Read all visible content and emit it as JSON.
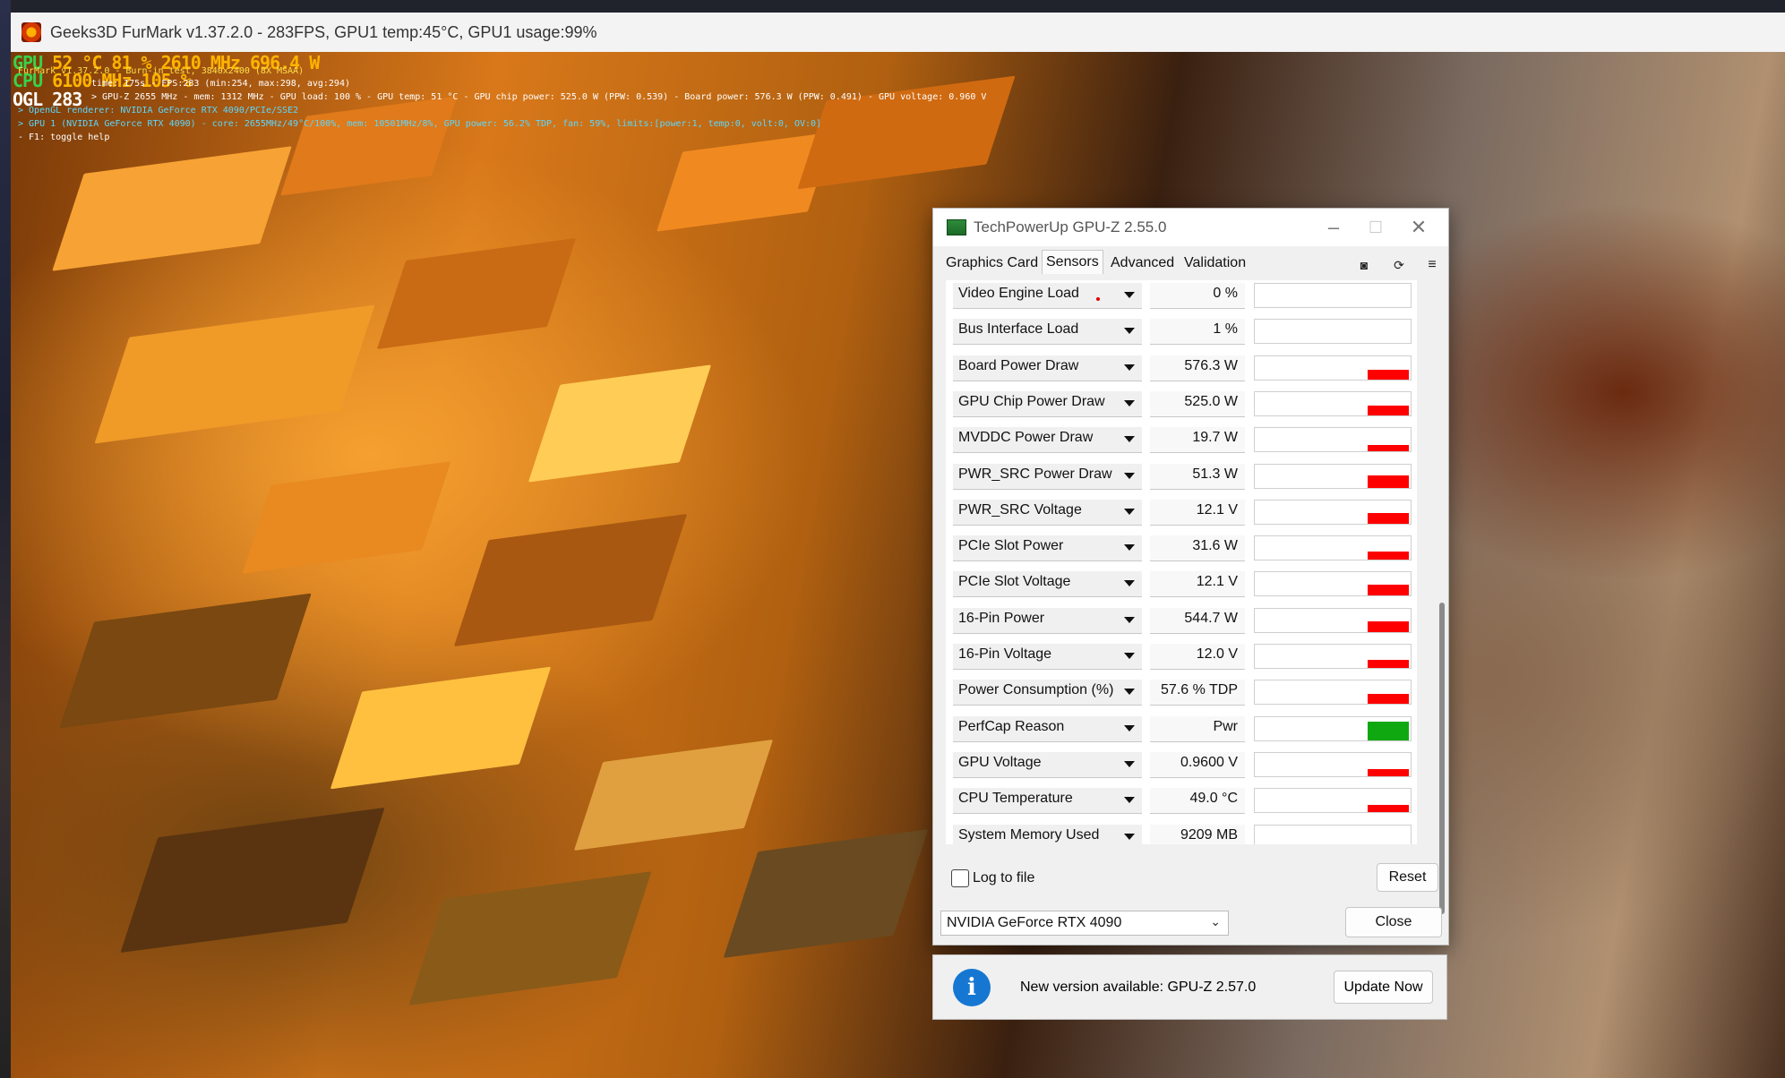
{
  "furmark": {
    "title": "Geeks3D FurMark v1.37.2.0 - 283FPS, GPU1 temp:45°C, GPU1 usage:99%",
    "hud": {
      "row1_label": "GPU",
      "row1_values": "52 °C   81 %   2610 MHz  696.4 W",
      "row2_label": "CPU",
      "row2_values": "6100 MHz  105 %",
      "row3_label": "OGL",
      "row3_values": "283",
      "line1": "FurMark v1.37.2.0 - Burn-in test, 3840x2400 (8X MSAA)",
      "line2": "time: 175s - FPS:283 (min:254, max:298, avg:294)",
      "line3": "> GPU-Z 2655 MHz - mem: 1312 MHz - GPU load: 100 % - GPU temp: 51 °C - GPU chip power: 525.0 W (PPW: 0.539) - Board power: 576.3 W (PPW: 0.491) - GPU voltage: 0.960 V",
      "line4": "> OpenGL renderer: NVIDIA GeForce RTX 4090/PCIe/SSE2",
      "line5": "> GPU 1 (NVIDIA GeForce RTX 4090) - core: 2655MHz/49°C/100%, mem: 10501MHz/8%, GPU power: 56.2% TDP, fan: 59%, limits:[power:1, temp:0, volt:0, OV:0]",
      "line6": "- F1: toggle help"
    }
  },
  "gpuz": {
    "title": "TechPowerUp GPU-Z 2.55.0",
    "tabs": [
      "Graphics Card",
      "Sensors",
      "Advanced",
      "Validation"
    ],
    "icons": [
      "camera-icon",
      "refresh-icon",
      "menu-icon"
    ],
    "sensors": [
      {
        "name": "Video Engine Load",
        "value": "0 %",
        "bar": 0,
        "color": "#ff0000"
      },
      {
        "name": "Bus Interface Load",
        "value": "1 %",
        "bar": 0,
        "color": "#ff0000"
      },
      {
        "name": "Board Power Draw",
        "value": "576.3 W",
        "bar": 0.42,
        "color": "#ff0000"
      },
      {
        "name": "GPU Chip Power Draw",
        "value": "525.0 W",
        "bar": 0.42,
        "color": "#ff0000"
      },
      {
        "name": "MVDDC Power Draw",
        "value": "19.7 W",
        "bar": 0.28,
        "color": "#ff0000"
      },
      {
        "name": "PWR_SRC Power Draw",
        "value": "51.3 W",
        "bar": 0.55,
        "color": "#ff0000"
      },
      {
        "name": "PWR_SRC Voltage",
        "value": "12.1 V",
        "bar": 0.45,
        "color": "#ff0000"
      },
      {
        "name": "PCIe Slot Power",
        "value": "31.6 W",
        "bar": 0.35,
        "color": "#ff0000"
      },
      {
        "name": "PCIe Slot Voltage",
        "value": "12.1 V",
        "bar": 0.45,
        "color": "#ff0000"
      },
      {
        "name": "16-Pin Power",
        "value": "544.7 W",
        "bar": 0.48,
        "color": "#ff0000"
      },
      {
        "name": "16-Pin Voltage",
        "value": "12.0 V",
        "bar": 0.35,
        "color": "#ff0000"
      },
      {
        "name": "Power Consumption (%)",
        "value": "57.6 % TDP",
        "bar": 0.42,
        "color": "#ff0000"
      },
      {
        "name": "PerfCap Reason",
        "value": "Pwr",
        "bar": 0.82,
        "color": "#10a810"
      },
      {
        "name": "GPU Voltage",
        "value": "0.9600 V",
        "bar": 0.32,
        "color": "#ff0000"
      },
      {
        "name": "CPU Temperature",
        "value": "49.0 °C",
        "bar": 0.3,
        "color": "#ff0000"
      },
      {
        "name": "System Memory Used",
        "value": "9209 MB",
        "bar": 0.15,
        "color": "#ff0000"
      }
    ],
    "log_label": "Log to file",
    "reset_label": "Reset",
    "device": "NVIDIA GeForce RTX 4090",
    "close_label": "Close"
  },
  "update": {
    "message": "New version available: GPU-Z 2.57.0",
    "button": "Update Now"
  }
}
